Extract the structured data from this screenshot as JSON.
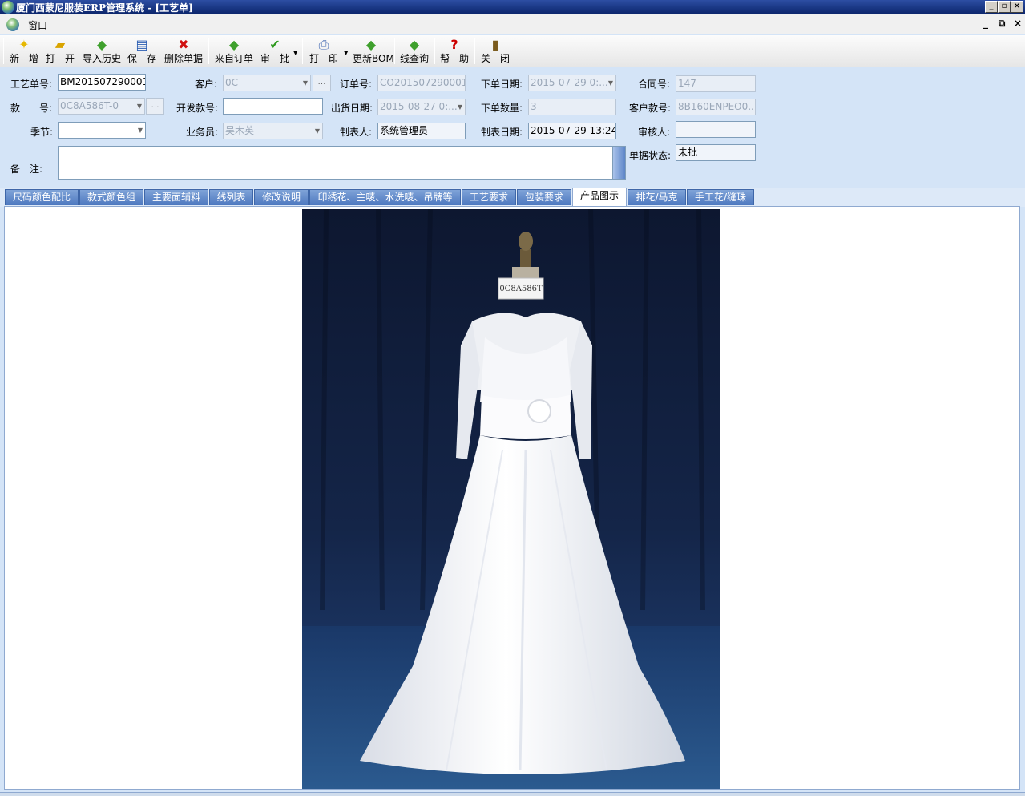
{
  "window": {
    "title": "厦门西蒙尼服装ERP管理系统 - [工艺单]"
  },
  "menu": {
    "window": "窗口"
  },
  "toolbar": {
    "new": "新　增",
    "open": "打　开",
    "import_history": "导入历史",
    "save": "保　存",
    "delete": "删除单据",
    "from_order": "来自订单",
    "approve": "审　批",
    "print": "打　印",
    "update_bom": "更新BOM",
    "thread_query": "线查询",
    "help": "帮　助",
    "close": "关　闭"
  },
  "form": {
    "craft_no_label": "工艺单号:",
    "craft_no": "BM201507290001",
    "customer_label": "客户:",
    "customer": "0C",
    "order_no_label": "订单号:",
    "order_no": "CO201507290001",
    "order_date_label": "下单日期:",
    "order_date": "2015-07-29 0:...",
    "contract_no_label": "合同号:",
    "contract_no": "147",
    "style_label": "款　　号:",
    "style": "0C8A586T-0",
    "dev_style_label": "开发款号:",
    "dev_style": "",
    "ship_date_label": "出货日期:",
    "ship_date": "2015-08-27 0:...",
    "order_qty_label": "下单数量:",
    "order_qty": "3",
    "customer_style_label": "客户款号:",
    "customer_style": "8B160ENPEO0...",
    "season_label": "季节:",
    "season": "",
    "salesman_label": "业务员:",
    "salesman": "吴木英",
    "maker_label": "制表人:",
    "maker": "系统管理员",
    "make_date_label": "制表日期:",
    "make_date": "2015-07-29 13:24:",
    "reviewer_label": "审核人:",
    "reviewer": "",
    "status_label": "单据状态:",
    "status": "未批",
    "remark_label": "备　注:",
    "remark": ""
  },
  "tabs": [
    "尺码颜色配比",
    "款式颜色组",
    "主要面辅料",
    "线列表",
    "修改说明",
    "印绣花、主唛、水洗唛、吊牌等",
    "工艺要求",
    "包装要求",
    "产品图示",
    "排花/马克",
    "手工花/缝珠"
  ],
  "active_tab": "产品图示",
  "photo": {
    "tag_text": "0C8A586T"
  },
  "colors": {
    "title_bar": "#0a246a",
    "tab_bg": "#4d78bf",
    "form_bg": "#dde9f8",
    "photo_bg": "#142548"
  }
}
